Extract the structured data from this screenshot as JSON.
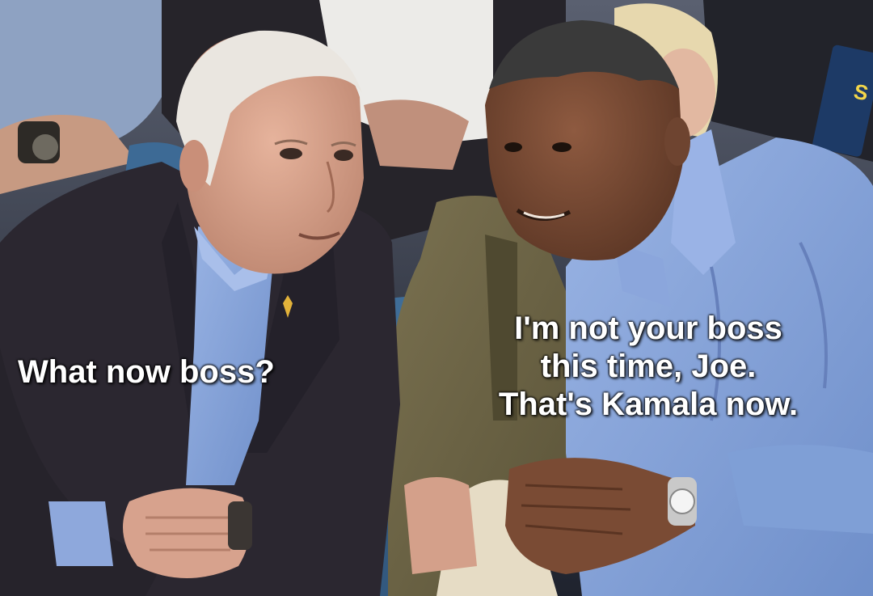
{
  "meme": {
    "left_caption": "What now boss?",
    "right_caption_lines": [
      "I'm not your boss",
      "this time, Joe.",
      "That's Kamala now."
    ]
  },
  "photo": {
    "subject": "two men in suits seated in stadium seats, one turned toward the other in conversation, with spectators behind",
    "colors": {
      "suit_dark": "#2b2730",
      "shirt_blue": "#7f9fd6",
      "jacket_olive": "#6d6445",
      "seat_blue": "#3d6a95",
      "skin_light": "#d7a28d",
      "skin_dark": "#7a4b34",
      "caption_text": "#ffffff"
    }
  }
}
